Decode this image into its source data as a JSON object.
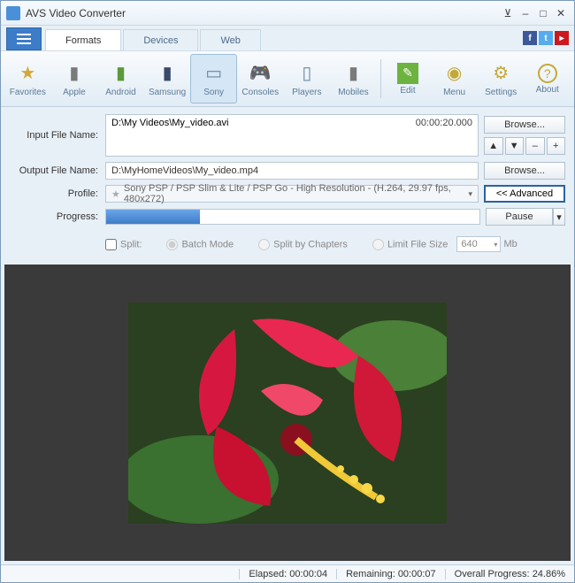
{
  "window": {
    "title": "AVS Video Converter"
  },
  "tabs": {
    "formats": "Formats",
    "devices": "Devices",
    "web": "Web"
  },
  "toolbar": {
    "favorites": "Favorites",
    "apple": "Apple",
    "android": "Android",
    "samsung": "Samsung",
    "sony": "Sony",
    "consoles": "Consoles",
    "players": "Players",
    "mobiles": "Mobiles",
    "edit": "Edit",
    "menu": "Menu",
    "settings": "Settings",
    "about": "About"
  },
  "labels": {
    "input": "Input File Name:",
    "output": "Output File Name:",
    "profile": "Profile:",
    "progress": "Progress:",
    "browse": "Browse...",
    "advanced": "<< Advanced",
    "pause": "Pause",
    "split": "Split:",
    "batch": "Batch Mode",
    "chapters": "Split by Chapters",
    "limit": "Limit File Size",
    "mb": "Mb"
  },
  "input": {
    "path": "D:\\My Videos\\My_video.avi",
    "duration": "00:00:20.000"
  },
  "output": {
    "path": "D:\\MyHomeVideos\\My_video.mp4"
  },
  "profile": {
    "text": "Sony PSP / PSP Slim & Lite / PSP Go - High Resolution - (H.264, 29.97 fps, 480x272)"
  },
  "progress": {
    "percent": 25
  },
  "split": {
    "size": "640"
  },
  "status": {
    "elapsed_label": "Elapsed:",
    "elapsed": "00:00:04",
    "remaining_label": "Remaining:",
    "remaining": "00:00:07",
    "overall_label": "Overall Progress:",
    "overall": "24.86%"
  }
}
